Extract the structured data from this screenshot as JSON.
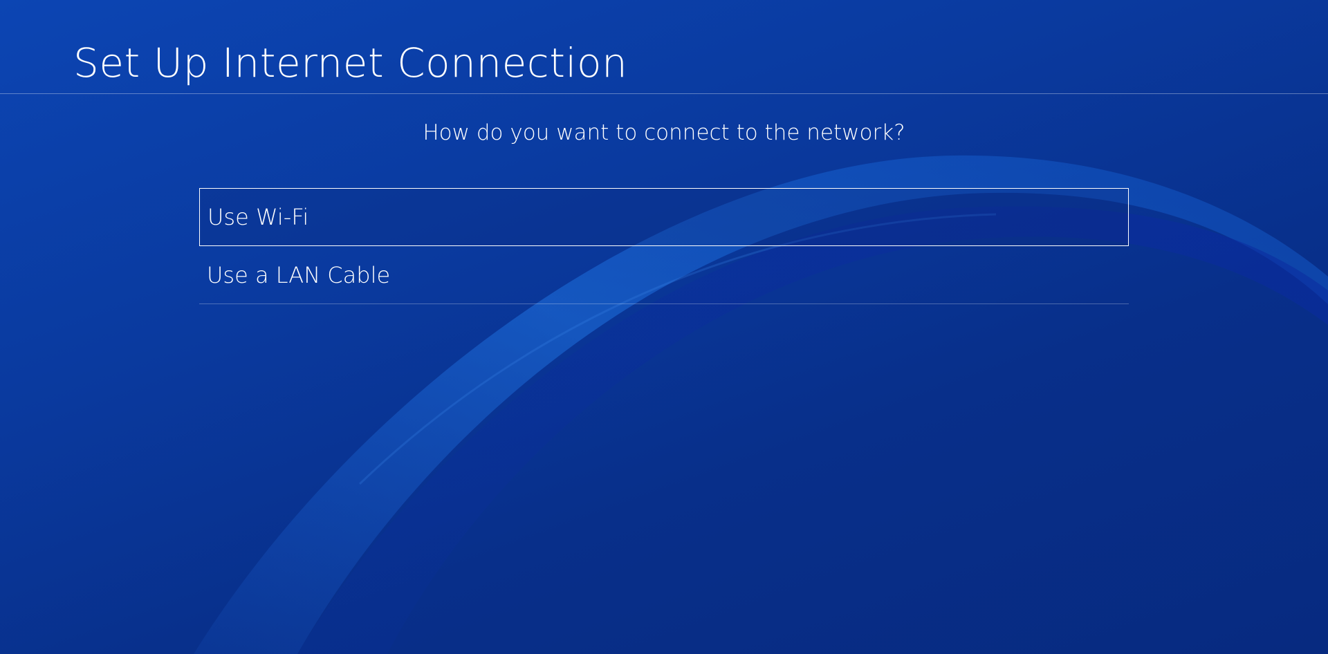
{
  "screen": {
    "title": "Set Up Internet Connection",
    "prompt": "How do you want to connect to the network?"
  },
  "options": [
    {
      "label": "Use Wi-Fi",
      "selected": true
    },
    {
      "label": "Use a LAN Cable",
      "selected": false
    }
  ],
  "colors": {
    "background_top": "#0c45b3",
    "background_bottom": "#072a80",
    "wave_light": "#1a6ad6",
    "text": "#ffffff"
  }
}
